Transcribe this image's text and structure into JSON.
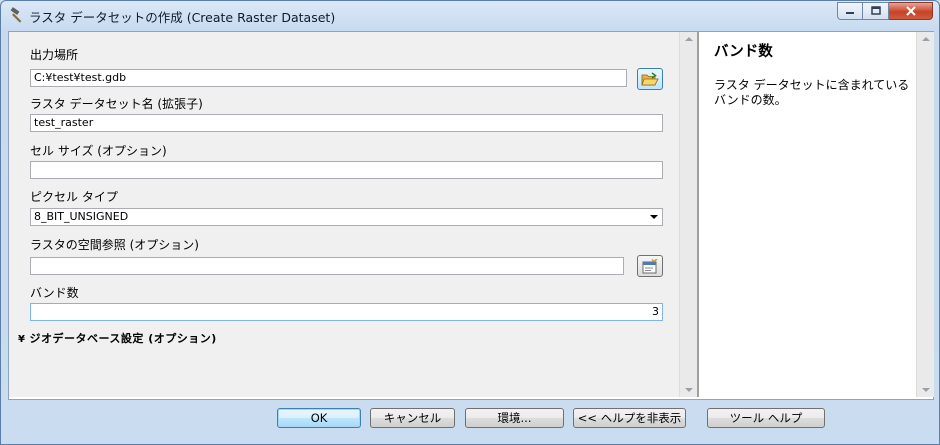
{
  "window": {
    "title": "ラスタ データセットの作成 (Create Raster Dataset)"
  },
  "icons": {
    "app": "hammer-icon",
    "browse_folder": "open-folder-icon",
    "spatial_ref": "properties-icon"
  },
  "form": {
    "output_location": {
      "label": "出力場所",
      "value": "C:¥test¥test.gdb"
    },
    "raster_name": {
      "label": "ラスタ データセット名 (拡張子)",
      "value": "test_raster"
    },
    "cell_size": {
      "label": "セル サイズ (オプション)",
      "value": ""
    },
    "pixel_type": {
      "label": "ピクセル タイプ",
      "value": "8_BIT_UNSIGNED"
    },
    "spatial_ref": {
      "label": "ラスタの空間参照 (オプション)",
      "value": ""
    },
    "band_count": {
      "label": "バンド数",
      "value": "3"
    },
    "env_settings": {
      "label": "ジオデータベース設定 (オプション)"
    }
  },
  "help": {
    "title": "バンド数",
    "body": "ラスタ データセットに含まれているバンドの数。"
  },
  "buttons": {
    "ok": "OK",
    "cancel": "キャンセル",
    "environments": "環境...",
    "hide_help": "<< ヘルプを非表示",
    "tool_help": "ツール ヘルプ"
  }
}
